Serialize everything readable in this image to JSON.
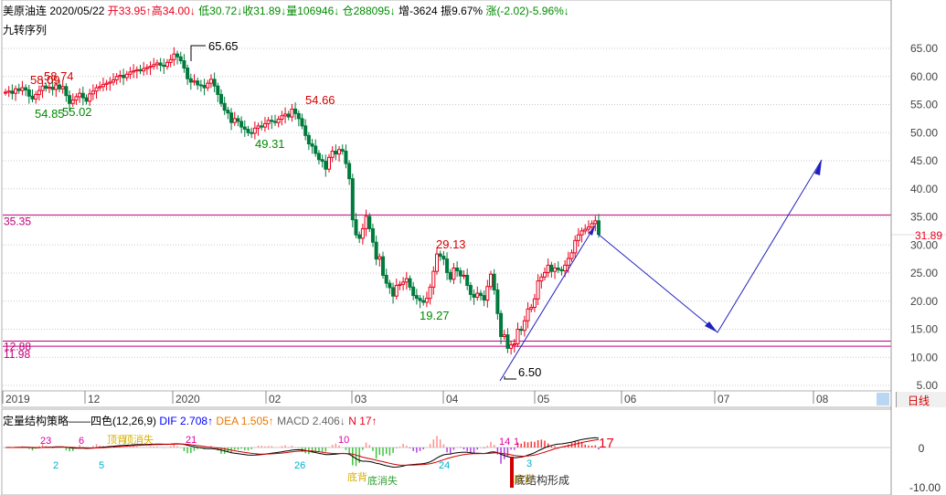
{
  "header": {
    "name": "美原油连",
    "date": "2020/05/22",
    "open": "开33.95↑",
    "high": "高34.00↓",
    "low": "低30.72↓",
    "close": "收31.89↓",
    "volume": "量106946↓",
    "oi": "仓288095↓",
    "oi_change": "增-3624",
    "amplitude": "振9.67%",
    "change": "涨(-2.02)-5.96%↓"
  },
  "indicator_name": "九转序列",
  "price_axis": {
    "ticks": [
      "65.00",
      "60.00",
      "55.00",
      "50.00",
      "45.00",
      "40.00",
      "35.00",
      "30.00",
      "25.00",
      "20.00",
      "15.00",
      "10.00",
      "5.00"
    ],
    "current_price": "31.89",
    "current_price_color": "#e8001c"
  },
  "time_axis": {
    "labels": [
      "2019",
      "12",
      "2020",
      "02",
      "03",
      "04",
      "05",
      "06",
      "07",
      "08"
    ]
  },
  "period": {
    "label": "日线"
  },
  "macd": {
    "title": "定量结构策略——四色(12,26,9)",
    "dif": "DIF 2.708↑",
    "dea": "DEA 1.505↑",
    "macd": "MACD 2.406↓",
    "n": "N 17↑",
    "axis_ticks": [
      "0",
      "-10.00"
    ],
    "big_label": "17",
    "labels_red": [
      "23",
      "6",
      "21",
      "10",
      "14",
      "1"
    ],
    "labels_cyan": [
      "2",
      "5",
      "26",
      "24",
      "3"
    ],
    "labels_yellow": [
      "顶背",
      "顶消失",
      "底背",
      "底背"
    ],
    "labels_green": [
      "底消失"
    ],
    "label_bottom": "底结构形成"
  },
  "lines": {
    "line_35": "35.35",
    "line_12": "12.88",
    "line_11": "11.98"
  },
  "chart_data": {
    "type": "candlestick",
    "x_range": [
      "2019-11",
      "2020-08"
    ],
    "ylim": [
      5,
      68
    ],
    "annotations": [
      {
        "text": "65.65",
        "price": 65.65,
        "kind": "high"
      },
      {
        "text": "58.74",
        "price": 58.74,
        "kind": "high"
      },
      {
        "text": "58.09",
        "price": 58.09,
        "kind": "high"
      },
      {
        "text": "54.85",
        "price": 54.85,
        "kind": "low"
      },
      {
        "text": "55.02",
        "price": 55.02,
        "kind": "low"
      },
      {
        "text": "54.66",
        "price": 54.66,
        "kind": "high"
      },
      {
        "text": "49.31",
        "price": 49.31,
        "kind": "low"
      },
      {
        "text": "29.13",
        "price": 29.13,
        "kind": "high"
      },
      {
        "text": "19.27",
        "price": 19.27,
        "kind": "low"
      },
      {
        "text": "6.50",
        "price": 6.5,
        "kind": "low"
      }
    ],
    "horizontal_lines": [
      35.35,
      12.88,
      11.98
    ],
    "closes": [
      57.2,
      57.4,
      57.0,
      57.8,
      57.5,
      58.0,
      57.6,
      56.5,
      56.0,
      56.8,
      57.5,
      58.3,
      57.9,
      58.1,
      57.7,
      58.5,
      57.8,
      58.2,
      56.6,
      55.2,
      55.8,
      56.4,
      57.0,
      56.2,
      55.6,
      56.9,
      57.4,
      58.0,
      58.2,
      58.6,
      58.8,
      59.0,
      59.4,
      60.0,
      60.2,
      59.8,
      60.4,
      60.8,
      61.0,
      61.2,
      61.0,
      61.4,
      61.6,
      61.8,
      62.1,
      62.4,
      62.0,
      61.8,
      62.5,
      63.0,
      64.0,
      63.5,
      62.8,
      61.5,
      59.6,
      59.0,
      59.2,
      58.5,
      58.4,
      58.0,
      58.8,
      59.5,
      58.3,
      56.8,
      55.2,
      54.0,
      53.5,
      51.8,
      52.5,
      52.0,
      51.0,
      50.6,
      50.0,
      49.9,
      50.8,
      51.2,
      51.0,
      51.6,
      52.2,
      52.0,
      51.8,
      52.4,
      53.0,
      53.3,
      52.8,
      54.2,
      53.4,
      52.5,
      51.2,
      49.5,
      48.0,
      47.6,
      46.3,
      45.2,
      44.9,
      43.5,
      45.6,
      46.7,
      46.2,
      47.0,
      46.7,
      44.5,
      41.8,
      34.5,
      31.8,
      31.2,
      32.9,
      35.1,
      32.9,
      30.5,
      27.5,
      27.9,
      24.6,
      23.2,
      22.4,
      20.9,
      22.8,
      23.0,
      23.4,
      24.0,
      22.5,
      21.0,
      20.5,
      20.1,
      19.8,
      20.5,
      22.5,
      25.3,
      28.4,
      28.0,
      27.5,
      25.1,
      23.9,
      25.9,
      25.4,
      24.5,
      24.6,
      22.8,
      21.2,
      20.7,
      21.4,
      21.0,
      20.2,
      22.6,
      24.8,
      22.0,
      17.8,
      13.7,
      14.0,
      11.6,
      12.2,
      12.4,
      15.0,
      14.8,
      16.5,
      18.6,
      18.9,
      20.4,
      23.6,
      24.3,
      25.1,
      26.4,
      25.3,
      25.9,
      25.6,
      25.4,
      26.4,
      27.6,
      28.6,
      30.8,
      31.8,
      32.5,
      32.8,
      33.2,
      33.8,
      34.3,
      31.9
    ]
  }
}
